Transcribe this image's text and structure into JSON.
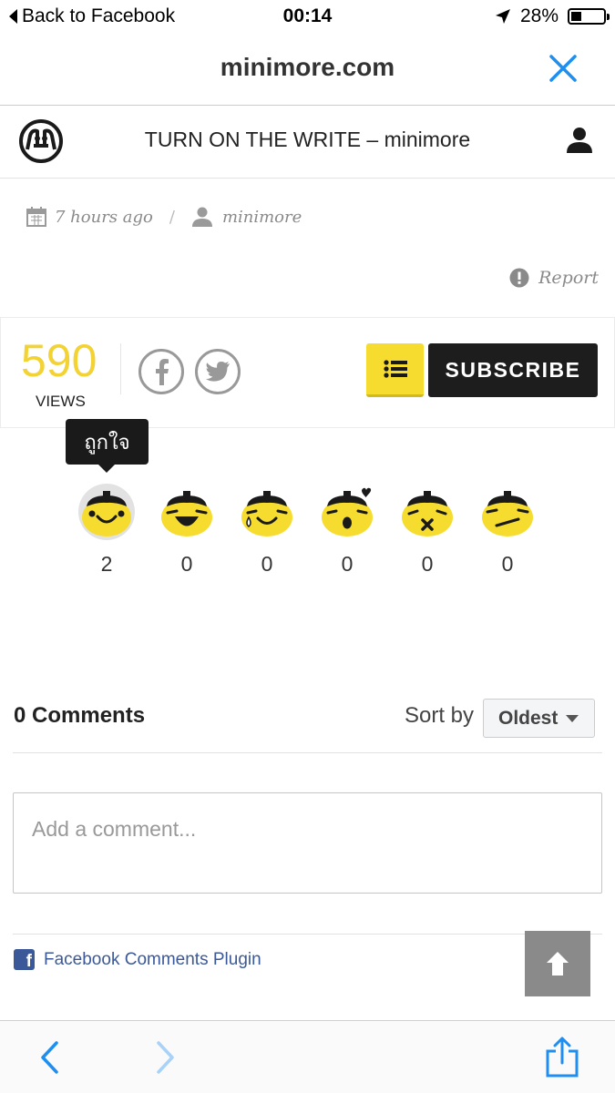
{
  "status_bar": {
    "back_label": "Back to Facebook",
    "time": "00:14",
    "battery": "28%"
  },
  "browser": {
    "domain": "minimore.com"
  },
  "site": {
    "title": "TURN ON THE WRITE – minimore"
  },
  "meta": {
    "time_ago": "7 hours ago",
    "separator": "/",
    "author": "minimore",
    "report_label": "Report"
  },
  "stats": {
    "views_count": "590",
    "views_label": "VIEWS",
    "subscribe_label": "SUBSCRIBE"
  },
  "reactions": {
    "tooltip": "ถูกใจ",
    "items": [
      {
        "name": "smile",
        "count": "2"
      },
      {
        "name": "laugh",
        "count": "0"
      },
      {
        "name": "tears-of-joy",
        "count": "0"
      },
      {
        "name": "wow-love",
        "count": "0"
      },
      {
        "name": "dead",
        "count": "0"
      },
      {
        "name": "meh",
        "count": "0"
      }
    ]
  },
  "comments": {
    "title": "0 Comments",
    "sort_label": "Sort by",
    "sort_value": "Oldest",
    "placeholder": "Add a comment...",
    "plugin_label": "Facebook Comments Plugin",
    "fb_letter": "f"
  },
  "colors": {
    "views": "#f3d233",
    "accent_yellow": "#f6dc2e",
    "subscribe_bg": "#1d1d1d",
    "ios_blue": "#1e8ff0",
    "facebook_blue": "#3b5998"
  }
}
